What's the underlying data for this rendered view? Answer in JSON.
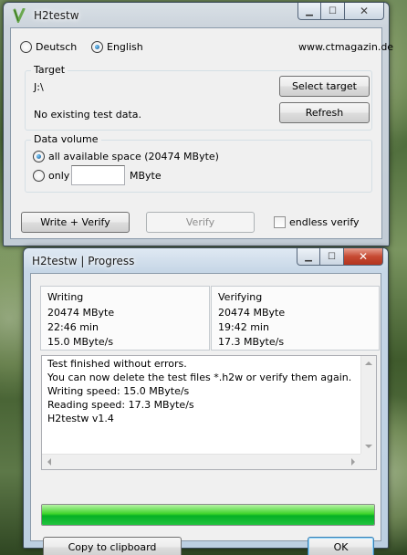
{
  "main_window": {
    "title": "H2testw",
    "language": {
      "options": [
        "Deutsch",
        "English"
      ],
      "selected": "English"
    },
    "website": "www.ctmagazin.de",
    "target": {
      "group_label": "Target",
      "path": "J:\\",
      "select_button": "Select target",
      "status": "No existing test data.",
      "refresh_button": "Refresh"
    },
    "data_volume": {
      "group_label": "Data volume",
      "all_space_label": "all available space (20474 MByte)",
      "only_label": "only",
      "only_value": "",
      "unit": "MByte",
      "selected": "all"
    },
    "write_verify_button": "Write + Verify",
    "verify_button": "Verify",
    "endless_verify_label": "endless verify",
    "endless_verify_checked": false
  },
  "progress_window": {
    "title": "H2testw | Progress",
    "writing": {
      "label": "Writing",
      "size": "20474 MByte",
      "time": "22:46 min",
      "speed": "15.0 MByte/s"
    },
    "verifying": {
      "label": "Verifying",
      "size": "20474 MByte",
      "time": "19:42 min",
      "speed": "17.3 MByte/s"
    },
    "log_lines": [
      "Test finished without errors.",
      "You can now delete the test files *.h2w or verify them again.",
      "Writing speed: 15.0 MByte/s",
      "Reading speed: 17.3 MByte/s",
      "H2testw v1.4"
    ],
    "progress_fraction": 1.0,
    "copy_button": "Copy to clipboard",
    "ok_button": "OK"
  },
  "colors": {
    "progress_green": "#06b025",
    "title_bar": "#c6d6e6",
    "client_bg": "#f0f0f0"
  },
  "icons": {
    "app": "h2testw-app-icon",
    "minimize": "minimize-icon",
    "maximize": "maximize-icon",
    "close": "close-icon"
  }
}
